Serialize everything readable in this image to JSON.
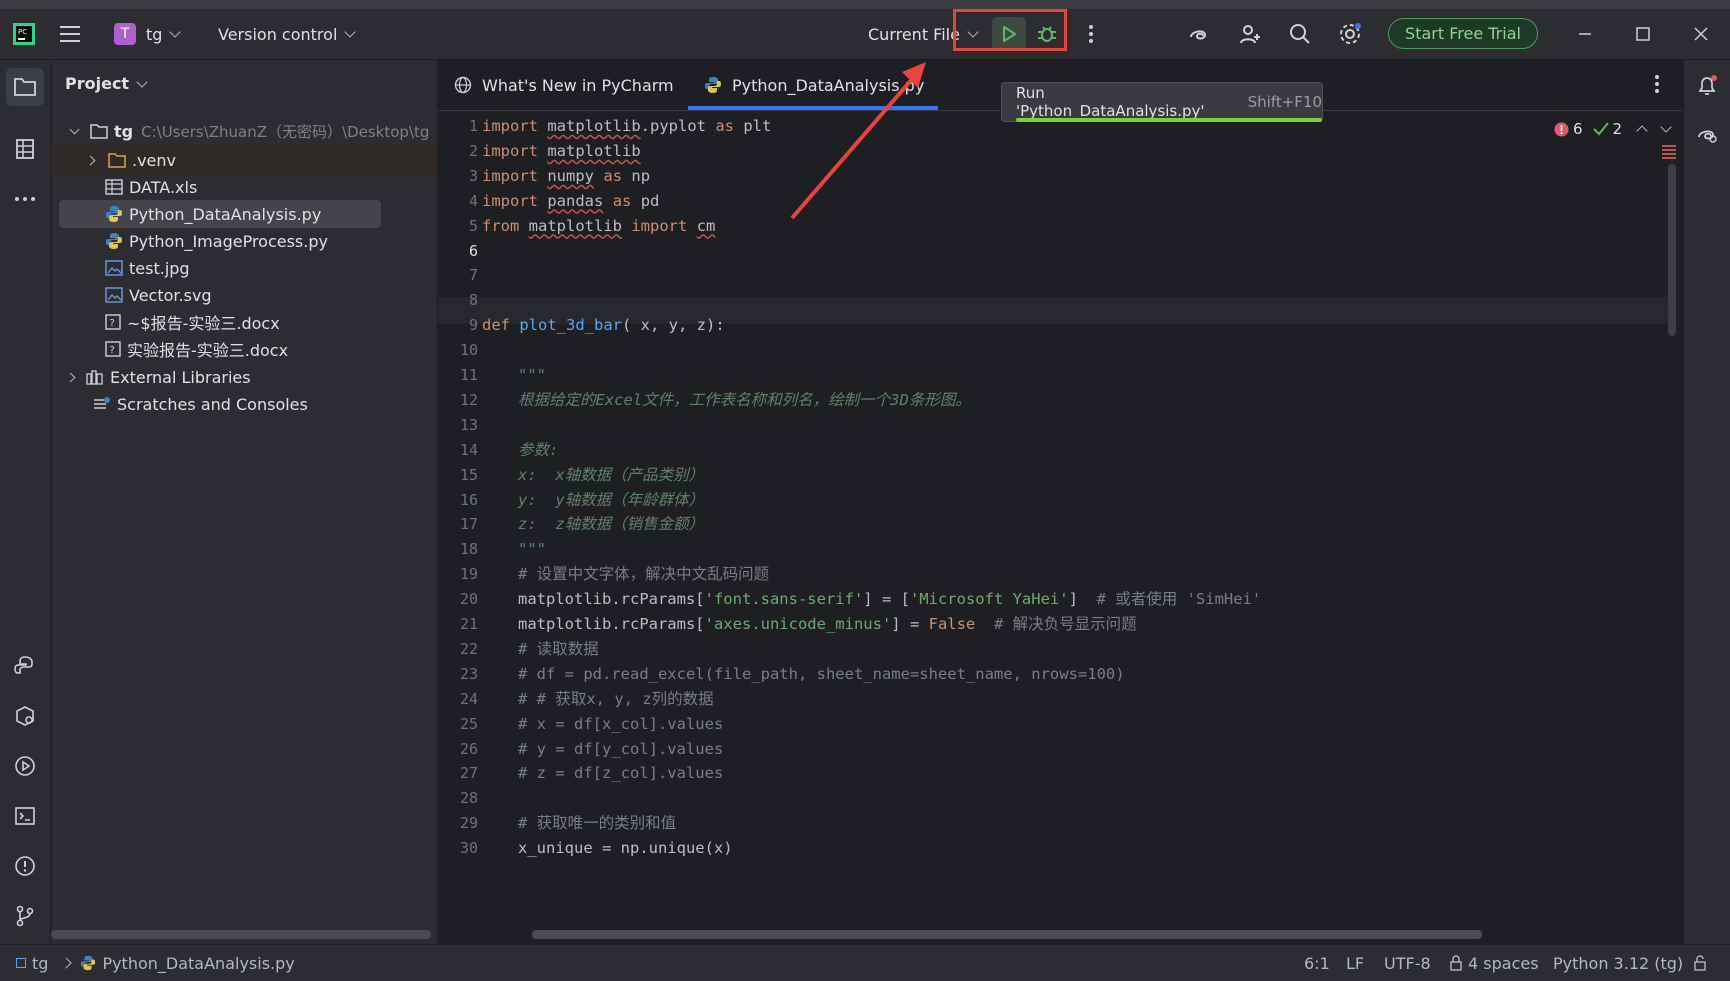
{
  "titlebar": {
    "project_initial": "T",
    "project_name": "tg",
    "vcs_label": "Version control",
    "run_config": "Current File",
    "trial_button": "Start Free Trial"
  },
  "tooltip": {
    "text": "Run 'Python_DataAnalysis.py'",
    "shortcut": "Shift+F10"
  },
  "project_panel": {
    "title": "Project",
    "root": {
      "name": "tg",
      "path": "C:\\Users\\ZhuanZ（无密码）\\Desktop\\tg"
    },
    "items": [
      {
        "label": ".venv",
        "icon": "folder-icon"
      },
      {
        "label": "DATA.xls",
        "icon": "table-icon"
      },
      {
        "label": "Python_DataAnalysis.py",
        "icon": "python-file-icon"
      },
      {
        "label": "Python_ImageProcess.py",
        "icon": "python-file-icon"
      },
      {
        "label": "test.jpg",
        "icon": "image-file-icon"
      },
      {
        "label": "Vector.svg",
        "icon": "image-file-icon"
      },
      {
        "label": "~$报告-实验三.docx",
        "icon": "unknown-file-icon"
      },
      {
        "label": "实验报告-实验三.docx",
        "icon": "unknown-file-icon"
      }
    ],
    "external_libraries": "External Libraries",
    "scratches": "Scratches and Consoles"
  },
  "tabs": [
    {
      "label": "What's New in PyCharm"
    },
    {
      "label": "Python_DataAnalysis.py"
    }
  ],
  "inspections": {
    "errors": "6",
    "warnings": "2"
  },
  "line_numbers": [
    "1",
    "2",
    "3",
    "4",
    "5",
    "6",
    "7",
    "8",
    "9",
    "10",
    "11",
    "12",
    "13",
    "14",
    "15",
    "16",
    "17",
    "18",
    "19",
    "20",
    "21",
    "22",
    "23",
    "24",
    "25",
    "26",
    "27",
    "28",
    "29",
    "30"
  ],
  "code": {
    "l1": [
      "import",
      "matplotlib",
      ".pyplot ",
      "as",
      " plt"
    ],
    "l2": [
      "import",
      "matplotlib"
    ],
    "l3": [
      "import",
      "numpy",
      "as",
      "np"
    ],
    "l4": [
      "import",
      "pandas",
      "as",
      "pd"
    ],
    "l5": [
      "from",
      "matplotlib",
      "import",
      "cm"
    ],
    "l9": [
      "def",
      "plot_3d_bar",
      "( x, y, z):"
    ],
    "l11": "\"\"\"",
    "l12": "根据给定的Excel文件，工作表名称和列名，绘制一个3D条形图。",
    "l14": "参数:",
    "l15": "x:  x轴数据（产品类别）",
    "l16": "y:  y轴数据（年龄群体）",
    "l17": "z:  z轴数据（销售金额）",
    "l18": "\"\"\"",
    "l19": "# 设置中文字体，解决中文乱码问题",
    "l20": [
      "matplotlib.rcParams[",
      "'font.sans-serif'",
      "] = [",
      "'Microsoft YaHei'",
      "]  ",
      "# 或者使用 'SimHei'"
    ],
    "l21": [
      "matplotlib.rcParams[",
      "'axes.unicode_minus'",
      "] = ",
      "False",
      "  ",
      "# 解决负号显示问题"
    ],
    "l22": "# 读取数据",
    "l23": "# df = pd.read_excel(file_path, sheet_name=sheet_name, nrows=100)",
    "l24": "# # 获取x, y, z列的数据",
    "l25": "# x = df[x_col].values",
    "l26": "# y = df[y_col].values",
    "l27": "# z = df[z_col].values",
    "l29": "# 获取唯一的类别和值",
    "l30": "x_unique = np.unique(x)"
  },
  "statusbar": {
    "crumb_root": "tg",
    "crumb_file": "Python_DataAnalysis.py",
    "position": "6:1",
    "line_sep": "LF",
    "encoding": "UTF-8",
    "indent": "4 spaces",
    "interpreter": "Python 3.12 (tg)"
  },
  "colors": {
    "accent": "#3574f0",
    "highlight_red": "#e8443a",
    "underline_green": "#7ad22f"
  }
}
